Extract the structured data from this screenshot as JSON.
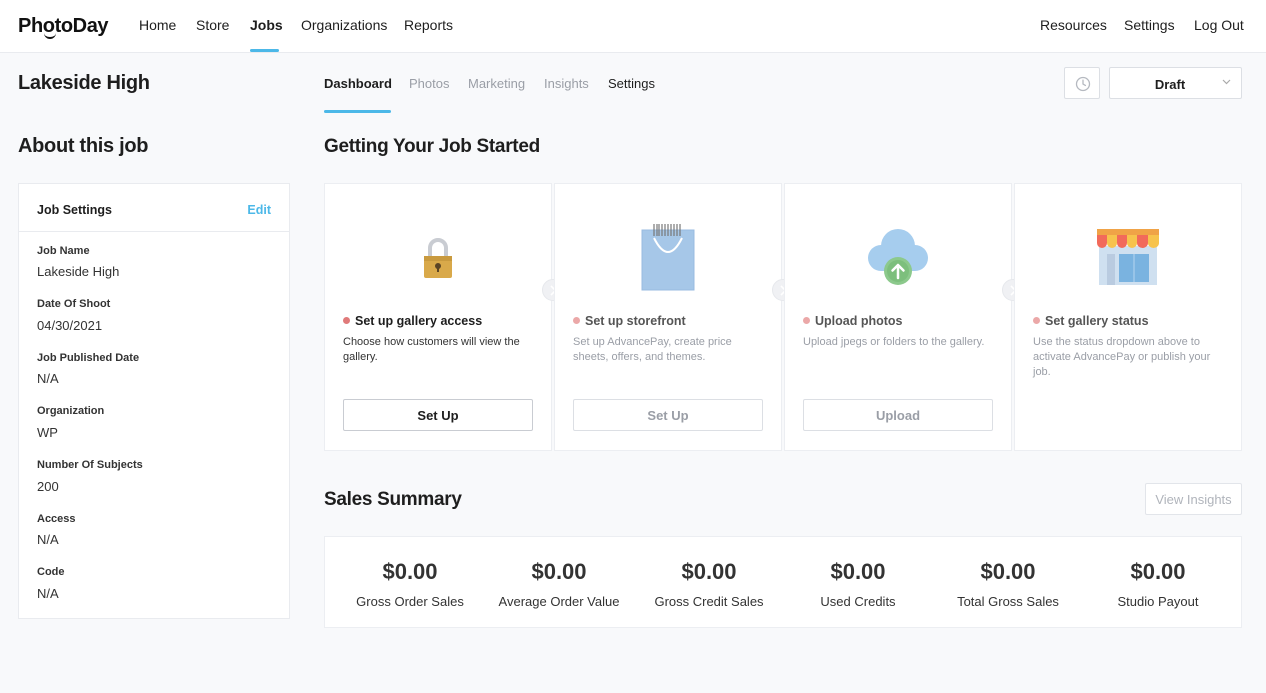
{
  "brand": {
    "name": "PhotoDay",
    "accent": "#4cb8e8",
    "step_dot": "#e07a7a"
  },
  "topnav": {
    "left": [
      "Home",
      "Store",
      "Jobs",
      "Organizations",
      "Reports"
    ],
    "active": "Jobs",
    "right": [
      "Resources",
      "Settings",
      "Log Out"
    ]
  },
  "job": {
    "title": "Lakeside High"
  },
  "about": {
    "title": "About this job",
    "card_title": "Job Settings",
    "edit_label": "Edit",
    "fields": [
      {
        "label": "Job Name",
        "value": "Lakeside High"
      },
      {
        "label": "Date Of Shoot",
        "value": "04/30/2021"
      },
      {
        "label": "Job Published Date",
        "value": "N/A"
      },
      {
        "label": "Organization",
        "value": "WP"
      },
      {
        "label": "Number Of Subjects",
        "value": "200"
      },
      {
        "label": "Access",
        "value": "N/A"
      },
      {
        "label": "Code",
        "value": "N/A"
      }
    ]
  },
  "subnav": {
    "tabs": [
      "Dashboard",
      "Photos",
      "Marketing",
      "Insights",
      "Settings"
    ],
    "active": "Dashboard"
  },
  "status_select": {
    "value": "Draft",
    "icon": "clock-icon"
  },
  "getting_started": {
    "title": "Getting Your Job Started",
    "steps": [
      {
        "icon": "lock-icon",
        "title": "Set up gallery access",
        "desc": "Choose how customers will view the gallery.",
        "button": "Set Up"
      },
      {
        "icon": "shopping-bag-icon",
        "title": "Set up storefront",
        "desc": "Set up AdvancePay, create price sheets, offers, and themes.",
        "button": "Set Up"
      },
      {
        "icon": "cloud-upload-icon",
        "title": "Upload photos",
        "desc": "Upload jpegs or folders to the gallery.",
        "button": "Upload"
      },
      {
        "icon": "storefront-icon",
        "title": "Set gallery status",
        "desc": "Use the status dropdown above to activate AdvancePay or publish your job.",
        "button": ""
      }
    ]
  },
  "sales": {
    "title": "Sales Summary",
    "view_insights": "View Insights",
    "metrics": [
      {
        "value": "$0.00",
        "label": "Gross Order Sales"
      },
      {
        "value": "$0.00",
        "label": "Average Order Value"
      },
      {
        "value": "$0.00",
        "label": "Gross Credit Sales"
      },
      {
        "value": "$0.00",
        "label": "Used Credits"
      },
      {
        "value": "$0.00",
        "label": "Total Gross Sales"
      },
      {
        "value": "$0.00",
        "label": "Studio Payout"
      }
    ]
  }
}
